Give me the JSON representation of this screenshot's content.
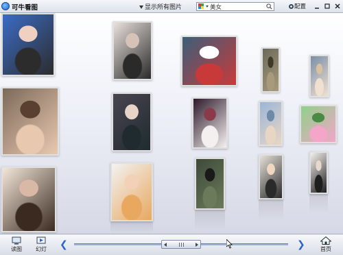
{
  "app": {
    "title": "可牛看图"
  },
  "toolbar": {
    "filter_label": "显示所有图片",
    "search": {
      "value": "美女",
      "placeholder": ""
    },
    "settings_label": "配置"
  },
  "bottom": {
    "view_label": "读图",
    "slideshow_label": "幻灯",
    "home_label": "首页",
    "prev_symbol": "❮",
    "next_symbol": "❯"
  },
  "icons": [
    "app-logo-icon",
    "filter-arrow-icon",
    "search-engine-icon",
    "search-icon",
    "gear-icon",
    "minimize-icon",
    "maximize-icon",
    "close-icon",
    "view-icon",
    "slideshow-icon",
    "prev-arrow-icon",
    "next-arrow-icon",
    "home-icon"
  ],
  "colors": {
    "accent": "#2b65c8",
    "background_top": "#ffffff",
    "background_bottom": "#d6d8e5"
  },
  "gallery": {
    "photos": [
      {
        "id": "photo-1",
        "tones": [
          "#3b6cc7",
          "#2c2c2c",
          "#f0d0c0"
        ]
      },
      {
        "id": "photo-2",
        "tones": [
          "#7c6a5a",
          "#e9c8b0",
          "#5a4030"
        ]
      },
      {
        "id": "photo-3",
        "tones": [
          "#f3e5d8",
          "#3a2a20",
          "#d9b8a6"
        ]
      },
      {
        "id": "photo-4",
        "tones": [
          "#3b5f7a",
          "#c83a3a",
          "#ffffff"
        ]
      },
      {
        "id": "photo-5",
        "tones": [
          "#6a6a5a",
          "#a89a7c",
          "#3e3a2a"
        ]
      },
      {
        "id": "photo-6",
        "tones": [
          "#e8e0dc",
          "#2a2a2a",
          "#d6c2b6"
        ]
      },
      {
        "id": "photo-7",
        "tones": [
          "#7a8ea8",
          "#f0e0d0",
          "#d8c0a0"
        ]
      },
      {
        "id": "photo-8",
        "tones": [
          "#4a4550",
          "#1f2b2f",
          "#e8d3c8"
        ]
      },
      {
        "id": "photo-9",
        "tones": [
          "#2d1a2a",
          "#f5f0f0",
          "#8b3a4a"
        ]
      },
      {
        "id": "photo-10",
        "tones": [
          "#9ab6d8",
          "#e8d6c4",
          "#6e8aa8"
        ]
      },
      {
        "id": "photo-11",
        "tones": [
          "#8fd08a",
          "#f3a6c8",
          "#4a8a44"
        ]
      },
      {
        "id": "photo-12",
        "tones": [
          "#d8dde2",
          "#7aa0c8",
          "#f0d8c0"
        ]
      },
      {
        "id": "photo-13",
        "tones": [
          "#b24a8a",
          "#2c2c2c",
          "#f0e8e0"
        ]
      },
      {
        "id": "photo-14",
        "tones": [
          "#3e4a3a",
          "#6b7a5a",
          "#1a1a1a"
        ]
      },
      {
        "id": "photo-15",
        "tones": [
          "#e6e0d8",
          "#2a2a2a",
          "#f0d8c0"
        ]
      },
      {
        "id": "photo-16",
        "tones": [
          "#f4f0ec",
          "#1e1e1e",
          "#e8d8cc"
        ]
      },
      {
        "id": "photo-17",
        "tones": [
          "#f2f2f2",
          "#e8a860",
          "#f3d0b8"
        ]
      }
    ]
  },
  "slider": {
    "position": 0.42
  }
}
